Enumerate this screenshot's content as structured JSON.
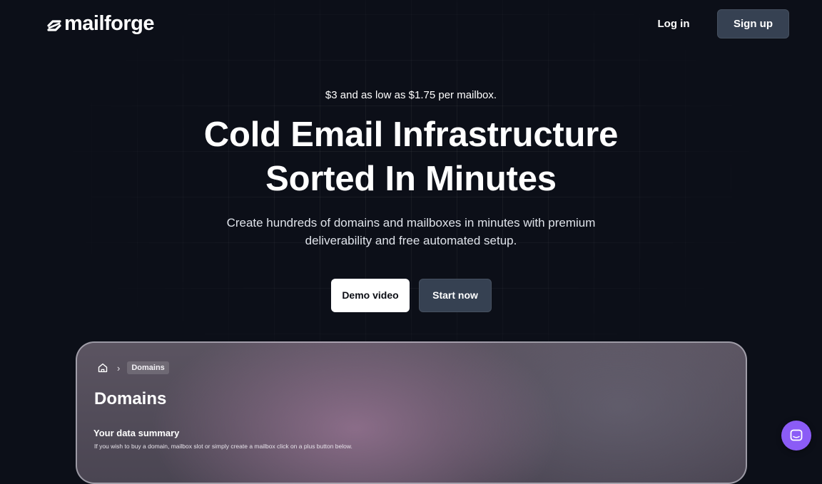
{
  "nav": {
    "logo_text": "mailforge",
    "login_label": "Log in",
    "signup_label": "Sign up"
  },
  "hero": {
    "eyebrow": "$3 and as low as $1.75 per mailbox.",
    "headline_line1": "Cold Email Infrastructure",
    "headline_line2": "Sorted In Minutes",
    "subtitle": "Create hundreds of domains and mailboxes in minutes with premium deliverability and free automated setup.",
    "demo_label": "Demo video",
    "start_label": "Start now"
  },
  "preview": {
    "breadcrumb": [
      "home-icon",
      "Domains"
    ],
    "title": "Domains",
    "summary_title": "Your data summary",
    "summary_desc": "If you wish to buy a domain, mailbox slot or simply create a mailbox click on a plus button below."
  },
  "icons": {
    "logo": "mailforge-logo-icon",
    "home": "home-icon",
    "chevron": "chevron-right-icon",
    "chat": "chat-icon"
  },
  "colors": {
    "background": "#0c0f18",
    "button_dark": "#364152",
    "button_light": "#ffffff",
    "chat_accent": "#8b5cf6"
  }
}
